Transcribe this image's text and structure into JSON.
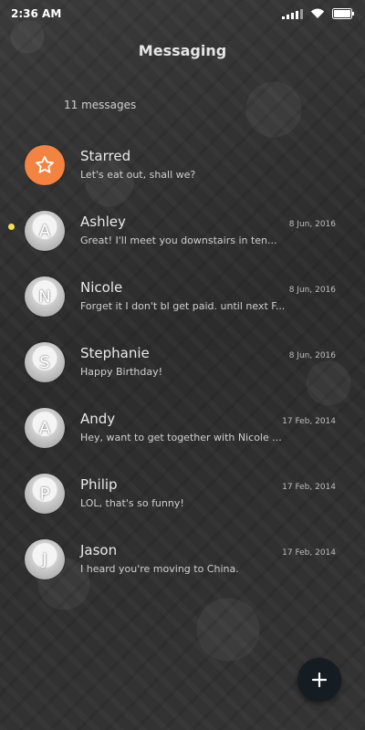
{
  "status_bar": {
    "time": "2:36 AM",
    "icons": [
      "signal-icon",
      "wifi-icon",
      "battery-icon"
    ]
  },
  "header": {
    "title": "Messaging",
    "message_count": "11 messages"
  },
  "conversations": [
    {
      "avatar": "star-icon",
      "avatar_letter": "",
      "name": "Starred",
      "snippet": "Let's eat out, shall we?",
      "date": ""
    },
    {
      "avatar": "letter",
      "avatar_letter": "A",
      "name": "Ashley",
      "snippet": "Great! I'll meet you downstairs in ten...",
      "date": "8 Jun, 2016"
    },
    {
      "avatar": "letter",
      "avatar_letter": "N",
      "name": "Nicole",
      "snippet": "Forget it I don't bl get paid. until next F...",
      "date": "8 Jun, 2016"
    },
    {
      "avatar": "letter",
      "avatar_letter": "S",
      "name": "Stephanie",
      "snippet": "Happy Birthday!",
      "date": "8 Jun, 2016"
    },
    {
      "avatar": "letter",
      "avatar_letter": "A",
      "name": "Andy",
      "snippet": "Hey, want to get together with Nicole ...",
      "date": "17 Feb, 2014"
    },
    {
      "avatar": "letter",
      "avatar_letter": "P",
      "name": "Philip",
      "snippet": "LOL, that's so funny!",
      "date": "17 Feb, 2014"
    },
    {
      "avatar": "letter",
      "avatar_letter": "J",
      "name": "Jason",
      "snippet": "I heard you're moving to China.",
      "date": "17 Feb, 2014"
    }
  ],
  "fab": {
    "icon": "plus-icon"
  },
  "colors": {
    "star_avatar": "#f28340",
    "fab_background": "#151c22",
    "unread_indicator": "#f0e050"
  }
}
